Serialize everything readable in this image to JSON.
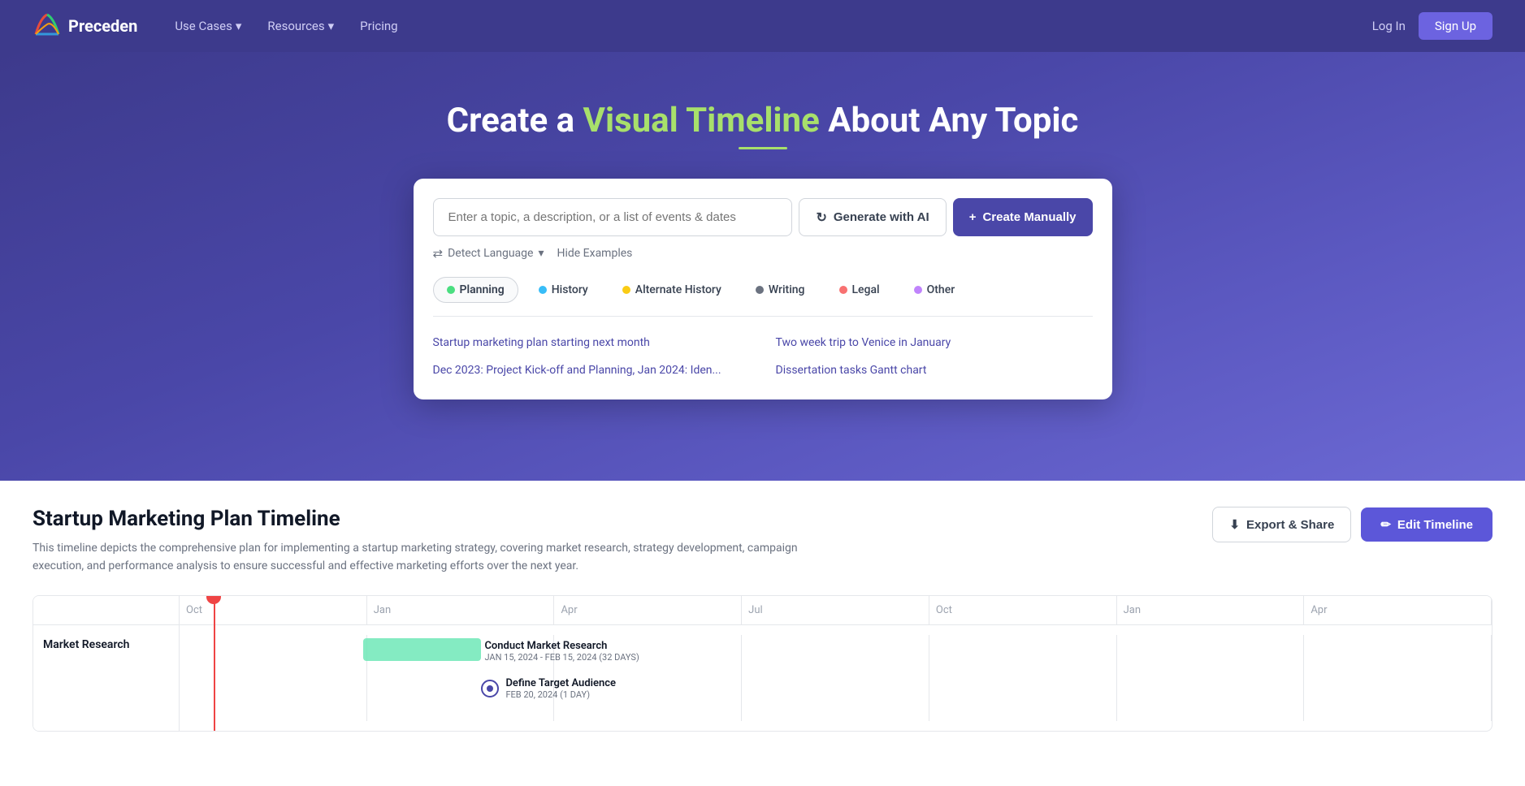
{
  "nav": {
    "logo_text": "Preceden",
    "links": [
      {
        "label": "Use Cases",
        "has_dropdown": true
      },
      {
        "label": "Resources",
        "has_dropdown": true
      },
      {
        "label": "Pricing",
        "has_dropdown": false
      }
    ],
    "right_links": [
      {
        "label": "Log In"
      },
      {
        "label": "Sign Up"
      }
    ]
  },
  "hero": {
    "title_prefix": "Create a ",
    "title_accent": "Visual Timeline",
    "title_suffix": " About Any Topic"
  },
  "search": {
    "placeholder": "Enter a topic, a description, or a list of events & dates",
    "generate_label": "Generate with AI",
    "create_label": "Create Manually",
    "detect_lang": "Detect Language",
    "hide_examples": "Hide Examples",
    "categories": [
      {
        "label": "Planning",
        "color": "#4ade80",
        "active": true
      },
      {
        "label": "History",
        "color": "#38bdf8",
        "active": false
      },
      {
        "label": "Alternate History",
        "color": "#facc15",
        "active": false
      },
      {
        "label": "Writing",
        "color": "#6b7280",
        "active": false
      },
      {
        "label": "Legal",
        "color": "#f87171",
        "active": false
      },
      {
        "label": "Other",
        "color": "#c084fc",
        "active": false
      }
    ],
    "examples": [
      "Startup marketing plan starting next month",
      "Two week trip to Venice in January",
      "Dec 2023: Project Kick-off and Planning, Jan 2024: Iden...",
      "Dissertation tasks Gantt chart"
    ]
  },
  "timeline": {
    "title": "Startup Marketing Plan Timeline",
    "description": "This timeline depicts the comprehensive plan for implementing a startup marketing strategy, covering market research, strategy development, campaign execution, and performance analysis to ensure successful and effective marketing efforts over the next year.",
    "export_label": "Export & Share",
    "edit_label": "Edit Timeline",
    "axis_months": [
      "Oct",
      "Jan",
      "Apr",
      "Jul",
      "Oct",
      "Jan",
      "Apr"
    ],
    "rows": [
      {
        "label": "Market Research",
        "events": [
          {
            "type": "bar",
            "title": "Conduct Market Research",
            "sub": "JAN 15, 2024 - FEB 15, 2024 (32 DAYS)",
            "color": "#6ee7b7",
            "left_pct": 14,
            "width_pct": 8
          },
          {
            "type": "milestone",
            "title": "Define Target Audience",
            "sub": "FEB 20, 2024 (1 DAY)",
            "left_pct": 23
          }
        ]
      }
    ]
  }
}
